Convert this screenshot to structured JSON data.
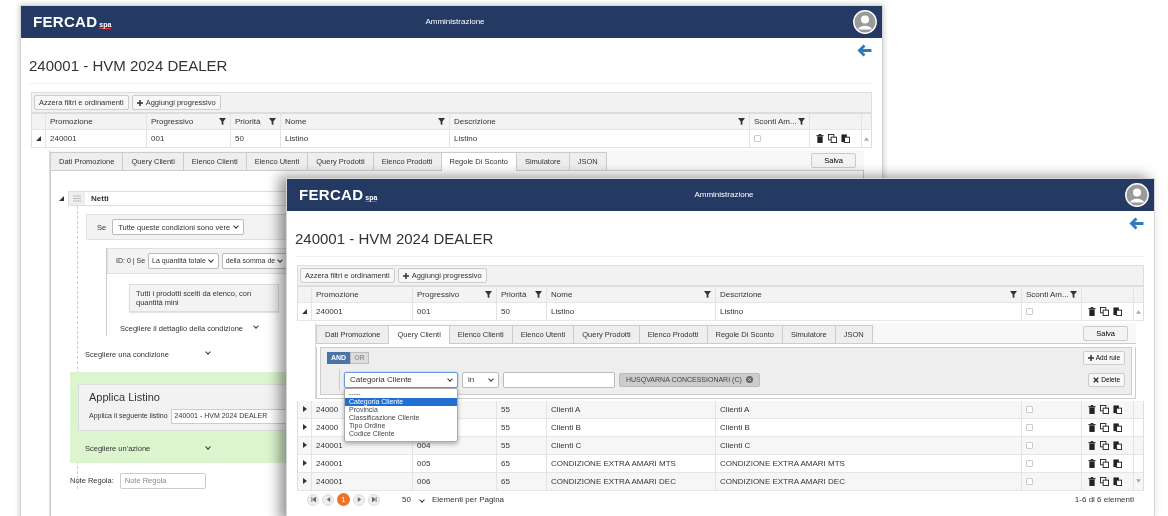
{
  "windows": [
    {
      "header": {
        "logo": "FERCAD",
        "logo_suffix": "spa",
        "title": "Amministrazione"
      },
      "page_title": "240001 - HVM 2024 DEALER",
      "toolbar": [
        {
          "label": "Azzera filtri e ordinamenti",
          "kind": "plain"
        },
        {
          "label": "Aggiungi progressivo",
          "kind": "add"
        }
      ],
      "columns": [
        {
          "label": "Promozione",
          "filter": false
        },
        {
          "label": "Progressivo",
          "filter": true
        },
        {
          "label": "Priorità",
          "filter": true
        },
        {
          "label": "Nome",
          "filter": true
        },
        {
          "label": "Descrizione",
          "filter": true
        },
        {
          "label": "Sconti Am...",
          "filter": true
        }
      ],
      "rows": [
        {
          "expanded": true,
          "promozione": "240001",
          "progressivo": "001",
          "priorita": "50",
          "nome": "Listino",
          "descrizione": "Listino",
          "sconti": false
        }
      ],
      "detail": {
        "tabs": [
          {
            "label": "Dati Promozione",
            "selected": false
          },
          {
            "label": "Query Clienti",
            "selected": false
          },
          {
            "label": "Elenco Clienti",
            "selected": false
          },
          {
            "label": "Elenco Utenti",
            "selected": false
          },
          {
            "label": "Query Prodotti",
            "selected": false
          },
          {
            "label": "Elenco Prodotti",
            "selected": false
          },
          {
            "label": "Regole Di Sconto",
            "selected": true
          },
          {
            "label": "Simulatore",
            "selected": false
          },
          {
            "label": "JSON",
            "selected": false
          }
        ],
        "save": "Salva",
        "kind": "rules",
        "rule": {
          "expanded": true,
          "name": "Netti",
          "if_label": "Se",
          "if_value": "Tutte queste condizioni sono vere",
          "conditions": [
            {
              "label": "ID: 0 | Se",
              "select_1": "La quantità totale",
              "select_2": "della somma de",
              "detail": "Tutti i prodotti scelti da elenco, con quantità mini",
              "choose_detail": "Scegliere il dettaglio della condizione"
            }
          ],
          "choose_condition": "Scegliere una condizione",
          "action": {
            "title": "Applica Listino",
            "label": "Applica il seguente listino",
            "value": "240001 - HVM 2024 DEALER"
          },
          "choose_action": "Scegliere un'azione",
          "note_label": "Note Regola:",
          "note_placeholder": "Note Regola"
        }
      }
    },
    {
      "header": {
        "logo": "FERCAD",
        "logo_suffix": "spa",
        "title": "Amministrazione"
      },
      "page_title": "240001 - HVM 2024 DEALER",
      "toolbar": [
        {
          "label": "Azzera filtri e ordinamenti",
          "kind": "plain"
        },
        {
          "label": "Aggiungi progressivo",
          "kind": "add"
        }
      ],
      "columns": [
        {
          "label": "Promozione",
          "filter": false
        },
        {
          "label": "Progressivo",
          "filter": true
        },
        {
          "label": "Priorità",
          "filter": true
        },
        {
          "label": "Nome",
          "filter": true
        },
        {
          "label": "Descrizione",
          "filter": true
        },
        {
          "label": "Sconti Am...",
          "filter": true
        }
      ],
      "rows": [
        {
          "expanded": true,
          "promozione": "240001",
          "progressivo": "001",
          "priorita": "50",
          "nome": "Listino",
          "descrizione": "Listino",
          "sconti": false
        },
        {
          "expanded": false,
          "promozione": "24000",
          "priorita": "55",
          "nome": "Clienti A",
          "descrizione": "Clienti A",
          "sconti": false
        },
        {
          "expanded": false,
          "promozione": "24000",
          "priorita": "55",
          "nome": "Clienti B",
          "descrizione": "Clienti B",
          "sconti": false
        },
        {
          "expanded": false,
          "promozione": "240001",
          "progressivo": "004",
          "priorita": "55",
          "nome": "Clienti C",
          "descrizione": "Clienti C",
          "sconti": false
        },
        {
          "expanded": false,
          "promozione": "240001",
          "progressivo": "005",
          "priorita": "65",
          "nome": "CONDIZIONE EXTRA AMARI MTS",
          "descrizione": "CONDIZIONE EXTRA AMARI MTS",
          "sconti": false
        },
        {
          "expanded": false,
          "promozione": "240001",
          "progressivo": "006",
          "priorita": "65",
          "nome": "CONDIZIONE EXTRA AMARI DEC",
          "descrizione": "CONDIZIONE EXTRA AMARI DEC",
          "sconti": false
        }
      ],
      "detail": {
        "tabs": [
          {
            "label": "Dati Promozione",
            "selected": false
          },
          {
            "label": "Query Clienti",
            "selected": true
          },
          {
            "label": "Elenco Clienti",
            "selected": false
          },
          {
            "label": "Elenco Utenti",
            "selected": false
          },
          {
            "label": "Query Prodotti",
            "selected": false
          },
          {
            "label": "Elenco Prodotti",
            "selected": false
          },
          {
            "label": "Regole Di Sconto",
            "selected": false
          },
          {
            "label": "Simulatore",
            "selected": false
          },
          {
            "label": "JSON",
            "selected": false
          }
        ],
        "save": "Salva",
        "kind": "query",
        "query": {
          "conjunctions": [
            {
              "label": "AND",
              "selected": true
            },
            {
              "label": "OR",
              "selected": false
            }
          ],
          "add_rule": "Add rule",
          "rules": [
            {
              "field": "Categoria Cliente",
              "operator": "in",
              "tag": "HUSQVARNA CONCESSIONARI (C)",
              "delete": "Delete",
              "open": true,
              "options": [
                {
                  "label": "-----",
                  "selected": false
                },
                {
                  "label": "Categoria Cliente",
                  "selected": true
                },
                {
                  "label": "Provincia",
                  "selected": false
                },
                {
                  "label": "Classificazione Cliente",
                  "selected": false
                },
                {
                  "label": "Tipo Ordine",
                  "selected": false
                },
                {
                  "label": "Codice Cliente",
                  "selected": false
                }
              ]
            }
          ]
        }
      },
      "pager": {
        "pages": [
          {
            "label": "1",
            "selected": true
          }
        ],
        "page_size": "50",
        "page_size_label": "Elementi per Pagina",
        "summary": "1-6 di 6 elementi"
      }
    }
  ]
}
